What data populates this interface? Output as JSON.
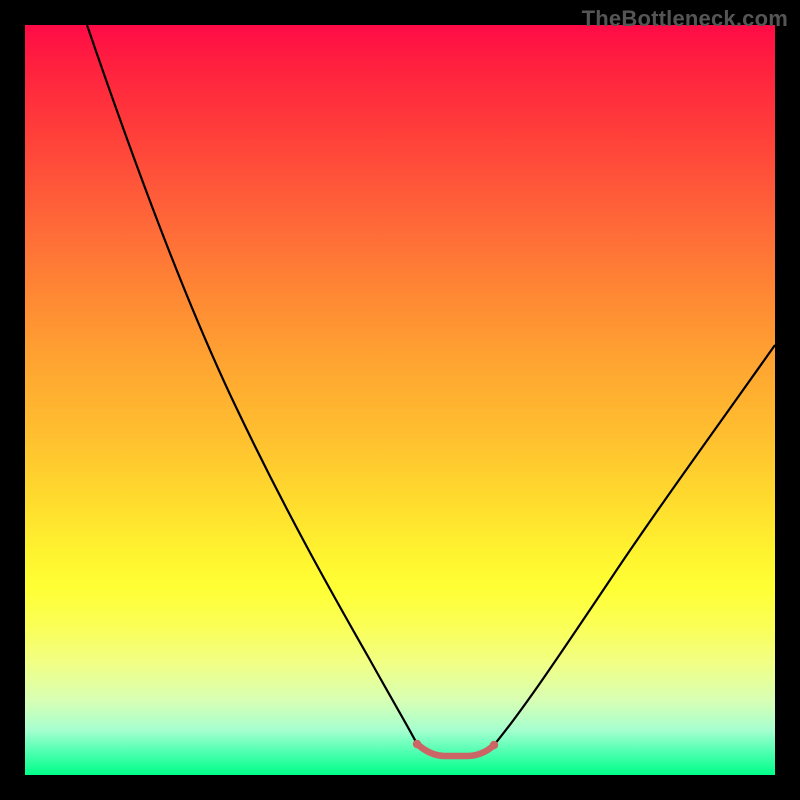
{
  "watermark": "TheBottleneck.com",
  "chart_data": {
    "type": "line",
    "title": "",
    "xlabel": "",
    "ylabel": "",
    "xlim": [
      0,
      100
    ],
    "ylim": [
      0,
      100
    ],
    "grid": false,
    "note": "Values are reconstructed positions in 0–100 space read from the image (x: left→right, y: bottom→top). Curve is a V-shape with a flat pink segment at the trough.",
    "series": [
      {
        "name": "bottleneck-curve",
        "color": "#000000",
        "x": [
          8.3,
          15,
          22,
          28,
          34,
          40,
          45,
          50.5,
          52.3
        ],
        "y": [
          100,
          81,
          63,
          49,
          36,
          24.5,
          15,
          6.5,
          4.1
        ]
      },
      {
        "name": "bottleneck-curve-right",
        "color": "#000000",
        "x": [
          62.5,
          65,
          70,
          76,
          83,
          90,
          97,
          100
        ],
        "y": [
          4.0,
          6.2,
          12.6,
          21.3,
          32,
          42.7,
          53,
          57.3
        ]
      },
      {
        "name": "flat-segment",
        "color": "#cc6666",
        "x": [
          52.3,
          54,
          56,
          58,
          60,
          62.5
        ],
        "y": [
          4.1,
          2.8,
          2.53,
          2.53,
          2.73,
          4.0
        ]
      }
    ],
    "flat_segment_endpoints": {
      "left_dot": {
        "x": 52.3,
        "y": 4.1
      },
      "right_dot": {
        "x": 62.5,
        "y": 4.0
      }
    },
    "gradient_stops": [
      {
        "pos": 0,
        "color": "#ff0b47"
      },
      {
        "pos": 25,
        "color": "#ff6339"
      },
      {
        "pos": 55,
        "color": "#ffc02f"
      },
      {
        "pos": 75,
        "color": "#ffff34"
      },
      {
        "pos": 90,
        "color": "#d8ffb4"
      },
      {
        "pos": 100,
        "color": "#00ff88"
      }
    ]
  }
}
